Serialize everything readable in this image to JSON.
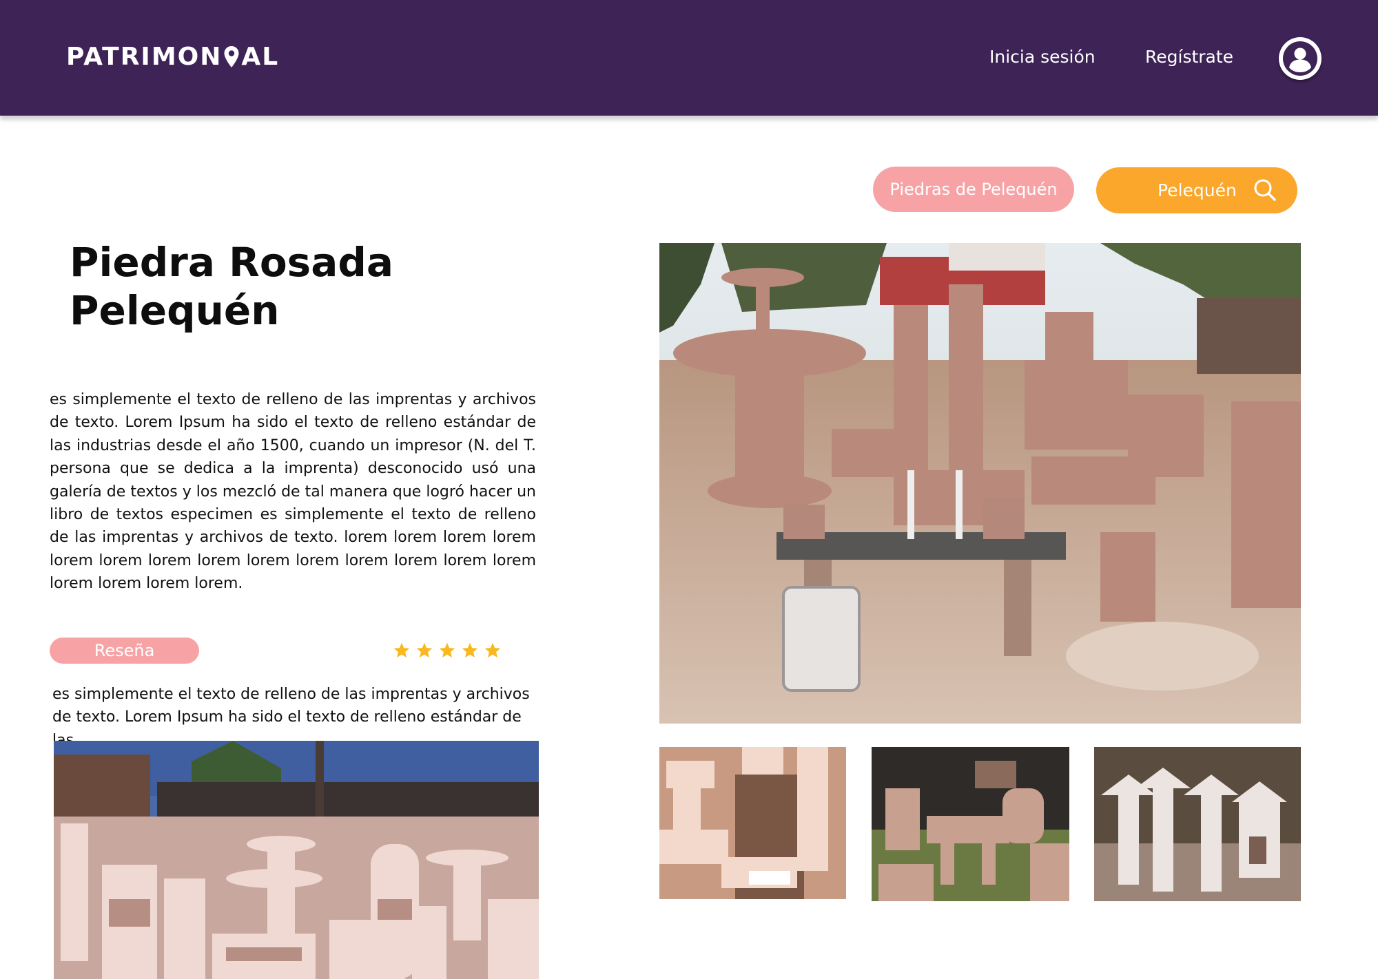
{
  "header": {
    "logo": {
      "before_pin": "PATRIMON",
      "after_pin": "AL"
    },
    "login_label": "Inicia sesión",
    "register_label": "Regístrate"
  },
  "tags": {
    "place_tag": "Piedras de Pelequén"
  },
  "search": {
    "value": "Pelequén"
  },
  "main": {
    "title": "Piedra Rosada\nPelequén",
    "description": "es simplemente el texto de relleno de las imprentas y archivos de texto. Lorem Ipsum ha sido el texto de relleno estándar de las industrias desde el año 1500, cuando un impresor (N. del T. persona que se dedica a la imprenta) desconocido usó una galería de textos y los mezcló de tal manera que logró hacer un libro de textos especimen es simplemente el texto de relleno de las imprentas y archivos de texto.  lorem lorem lorem lorem lorem lorem lorem lorem lorem lorem lorem lorem lorem lorem lorem lorem lorem lorem."
  },
  "review": {
    "label": "Reseña",
    "rating": 5,
    "max_rating": 5,
    "text": "es simplemente el texto de relleno de las imprentas y archivos de texto. Lorem Ipsum ha sido el texto de relleno estándar de las"
  },
  "colors": {
    "header_bg": "#3e2357",
    "pill_pink": "#f7a3a6",
    "search_orange": "#fba72c",
    "star_yellow": "#f9b81f"
  },
  "icons": [
    "location-pin-icon",
    "user-avatar-icon",
    "search-icon",
    "star-icon"
  ]
}
